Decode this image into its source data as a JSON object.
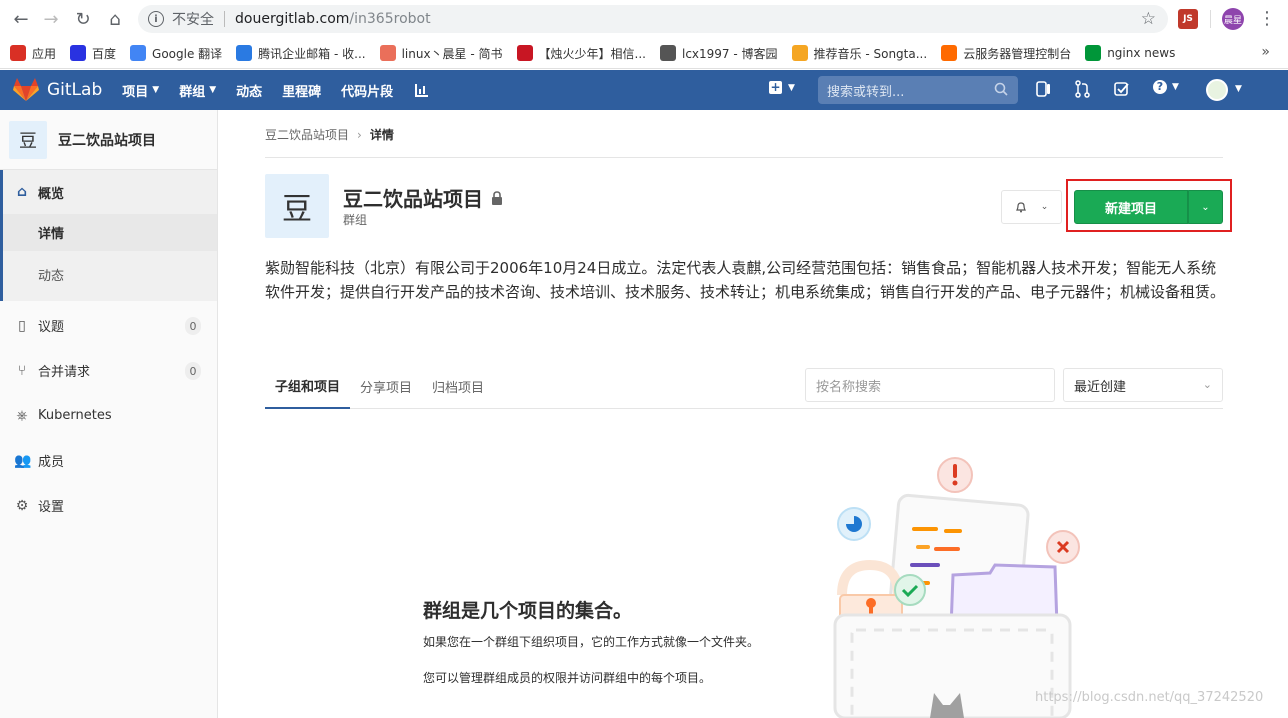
{
  "browser": {
    "insecure_label": "不安全",
    "url_host": "douergitlab.com",
    "url_path": "/in365robot",
    "ext_js": "JS",
    "profile": "晨星"
  },
  "bookmarks": [
    {
      "label": "应用",
      "icon_color": "#d93025",
      "icon": "apps-icon"
    },
    {
      "label": "百度",
      "icon_color": "#2932e1",
      "icon": "baidu-icon"
    },
    {
      "label": "Google 翻译",
      "icon_color": "#4285f4",
      "icon": "google-translate-icon"
    },
    {
      "label": "腾讯企业邮箱 - 收...",
      "icon_color": "#2a7ae2",
      "icon": "tencent-mail-icon"
    },
    {
      "label": "linux丶晨星 - 简书",
      "icon_color": "#ea6f5a",
      "icon": "jianshu-icon"
    },
    {
      "label": "【烛火少年】相信...",
      "icon_color": "#c81623",
      "icon": "csdn-icon"
    },
    {
      "label": "lcx1997 - 博客园",
      "icon_color": "#555555",
      "icon": "cnblogs-icon"
    },
    {
      "label": "推荐音乐 - Songta...",
      "icon_color": "#f5a623",
      "icon": "music-icon"
    },
    {
      "label": "云服务器管理控制台",
      "icon_color": "#ff6a00",
      "icon": "aliyun-icon"
    },
    {
      "label": "nginx news",
      "icon_color": "#009639",
      "icon": "nginx-icon"
    }
  ],
  "header": {
    "brand": "GitLab",
    "nav": [
      {
        "label": "项目",
        "caret": true
      },
      {
        "label": "群组",
        "caret": true
      },
      {
        "label": "动态",
        "caret": false
      },
      {
        "label": "里程碑",
        "caret": false
      },
      {
        "label": "代码片段",
        "caret": false
      }
    ],
    "search_placeholder": "搜索或转到..."
  },
  "sidebar": {
    "group_avatar": "豆",
    "group_name": "豆二饮品站项目",
    "overview": "概览",
    "overview_sub": [
      "详情",
      "动态"
    ],
    "items": [
      {
        "label": "议题",
        "badge": "0",
        "icon": "issues-icon"
      },
      {
        "label": "合并请求",
        "badge": "0",
        "icon": "merge-request-icon"
      },
      {
        "label": "Kubernetes",
        "badge": null,
        "icon": "kubernetes-icon"
      },
      {
        "label": "成员",
        "badge": null,
        "icon": "members-icon"
      },
      {
        "label": "设置",
        "badge": null,
        "icon": "settings-icon"
      }
    ]
  },
  "main": {
    "breadcrumb": [
      "豆二饮品站项目",
      "详情"
    ],
    "group_avatar": "豆",
    "group_title": "豆二饮品站项目",
    "group_type": "群组",
    "new_project": "新建项目",
    "description": "紫勋智能科技（北京）有限公司于2006年10月24日成立。法定代表人袁麒,公司经营范围包括：销售食品；智能机器人技术开发；智能无人系统软件开发；提供自行开发产品的技术咨询、技术培训、技术服务、技术转让；机电系统集成；销售自行开发的产品、电子元器件；机械设备租赁。",
    "tabs": [
      "子组和项目",
      "分享项目",
      "归档项目"
    ],
    "search_placeholder": "按名称搜索",
    "sort_value": "最近创建",
    "empty_title": "群组是几个项目的集合。",
    "empty_p1": "如果您在一个群组下组织项目，它的工作方式就像一个文件夹。",
    "empty_p2": "您可以管理群组成员的权限并访问群组中的每个项目。"
  },
  "watermark": "https://blog.csdn.net/qq_37242520",
  "colors": {
    "header": "#2f5e9e",
    "primary_green": "#1aaa55",
    "highlight_red": "#e02020"
  }
}
